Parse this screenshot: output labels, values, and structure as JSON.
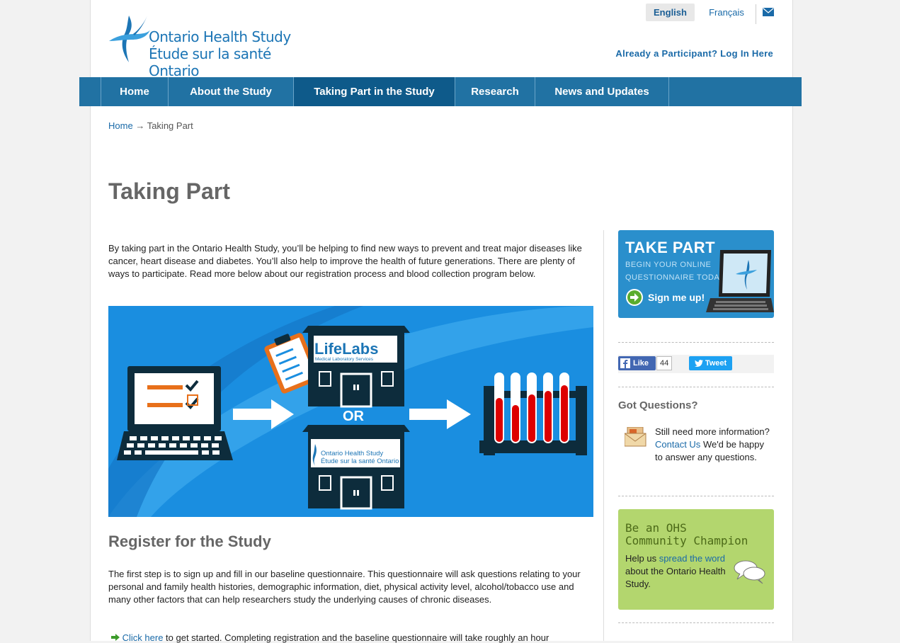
{
  "header": {
    "logo_line1": "Ontario Health Study",
    "logo_line2": "Étude sur la santé Ontario",
    "lang_english": "English",
    "lang_french": "Français",
    "login_link": "Already a Participant? Log In Here"
  },
  "nav": {
    "items": [
      {
        "label": "Home"
      },
      {
        "label": "About the Study"
      },
      {
        "label": "Taking Part in the Study"
      },
      {
        "label": "Research"
      },
      {
        "label": "News and Updates"
      }
    ],
    "active_index": 2
  },
  "breadcrumb": {
    "home": "Home",
    "separator": "→",
    "current": "Taking Part"
  },
  "main": {
    "title": "Taking Part",
    "intro": "By taking part in the Ontario Health Study, you’ll be helping to find new ways to prevent and treat major diseases like cancer, heart disease and diabetes. You’ll also help to improve the health of future generations. There are plenty of ways to participate. Read more below about our registration process and blood collection program below.",
    "hero": {
      "lifelabs_name": "LifeLabs",
      "lifelabs_sub": "Medical Laboratory Services",
      "or_label": "OR",
      "ohs_line1": "Ontario Health Study",
      "ohs_line2": "Étude sur la santé Ontario"
    },
    "register_title": "Register for the Study",
    "register_text": "The first step is to sign up and fill in our baseline questionnaire. This questionnaire will ask questions relating to your personal and family health histories, demographic information, diet, physical activity level, alcohol/tobacco use and many other factors that can help researchers study the underlying causes of chronic diseases.",
    "click_here": "Click here",
    "click_rest": "to get started. Completing registration and the baseline questionnaire will take roughly an hour"
  },
  "sidebar": {
    "take_part": {
      "title": "TAKE PART",
      "sub_line1": "BEGIN YOUR ONLINE",
      "sub_line2": "QUESTIONNAIRE TODAY.",
      "button": "Sign me up!"
    },
    "social": {
      "like_label": "Like",
      "like_count": "44",
      "tweet_label": "Tweet"
    },
    "questions": {
      "title": "Got Questions?",
      "text_before": "Still need more information?",
      "contact_link": "Contact Us",
      "text_after": "We'd be happy to answer any questions."
    },
    "champion": {
      "title_line1": "Be an OHS",
      "title_line2": "Community Champion",
      "text_before": "Help us",
      "link": "spread the word",
      "text_after": "about the Ontario Health Study."
    }
  },
  "colors": {
    "nav_bg": "#2172a3",
    "nav_active": "#0e5a8a",
    "link": "#1a6aa8",
    "hero_bg": "#1a8ee0",
    "champion_bg": "#b3d66e",
    "takepart_bg": "#2a8fcc"
  }
}
